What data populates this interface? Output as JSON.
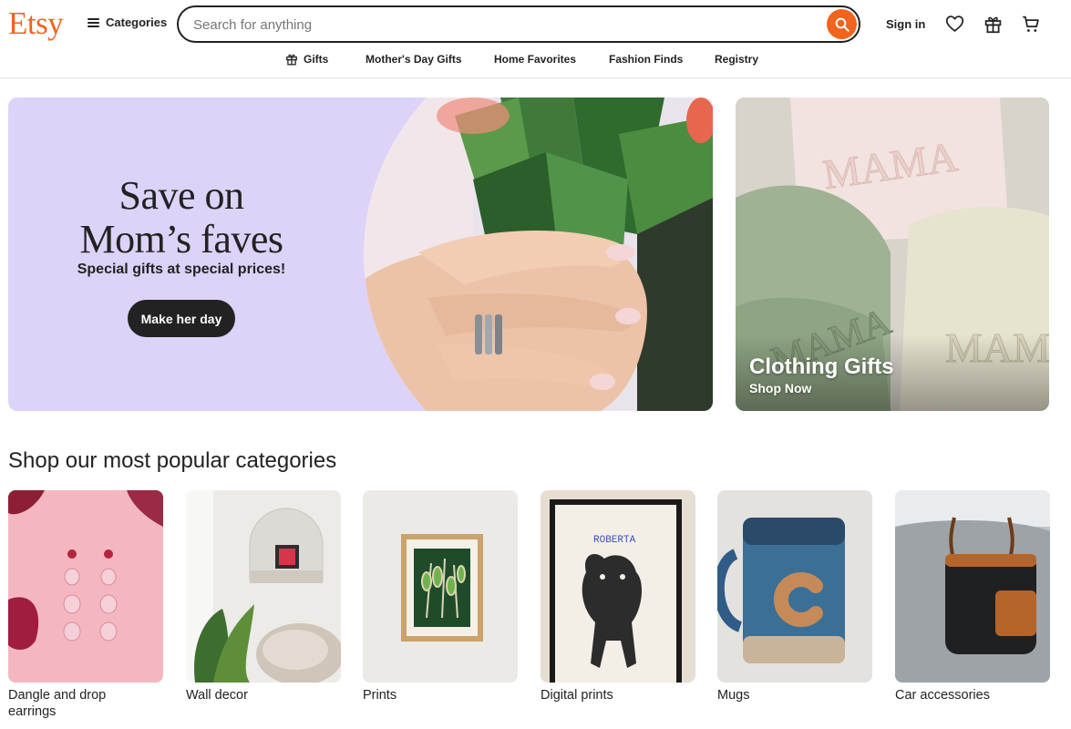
{
  "header": {
    "logo": "Etsy",
    "categories_label": "Categories",
    "search_placeholder": "Search for anything",
    "sign_in_label": "Sign in",
    "icons": [
      "search-icon",
      "heart-icon",
      "gift-icon",
      "cart-icon"
    ],
    "accent_color": "#f1641e"
  },
  "nav": {
    "items": [
      {
        "label": "Gifts",
        "icon": "gift-icon"
      },
      {
        "label": "Mother's Day Gifts"
      },
      {
        "label": "Home Favorites"
      },
      {
        "label": "Fashion Finds"
      },
      {
        "label": "Registry"
      }
    ]
  },
  "hero": {
    "title_line1": "Save on",
    "title_line2": "Mom’s faves",
    "subtitle": "Special gifts at special prices!",
    "button_label": "Make her day",
    "background_color": "#ddd3f8"
  },
  "promo": {
    "title": "Clothing Gifts",
    "subtitle": "Shop Now"
  },
  "popular": {
    "title": "Shop our most popular categories",
    "items": [
      {
        "label": "Dangle and drop earrings"
      },
      {
        "label": "Wall decor"
      },
      {
        "label": "Prints"
      },
      {
        "label": "Digital prints"
      },
      {
        "label": "Mugs"
      },
      {
        "label": "Car accessories"
      }
    ]
  }
}
